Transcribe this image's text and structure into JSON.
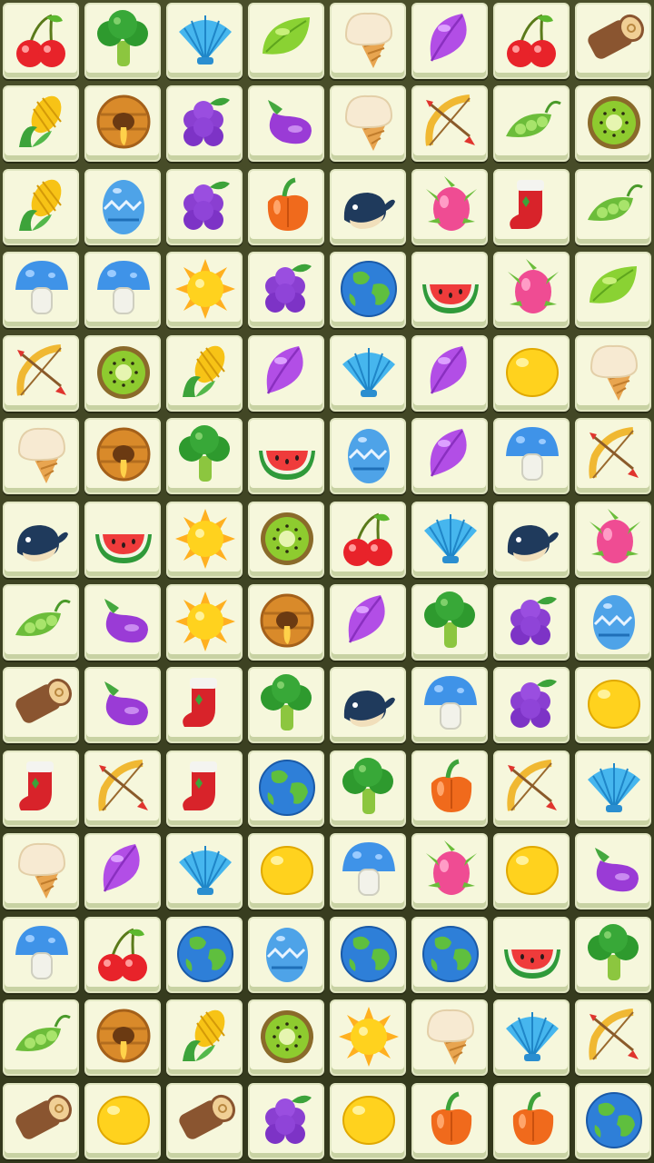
{
  "board": {
    "columns": 8,
    "rows": 14,
    "tiles": [
      [
        "cherry",
        "broccoli",
        "shell",
        "lime",
        "ice-cream",
        "leaf",
        "cherry",
        "log"
      ],
      [
        "corn",
        "honeycomb",
        "grapes",
        "eggplant",
        "ice-cream",
        "bow-arrow",
        "pea-pod",
        "kiwi"
      ],
      [
        "corn",
        "easter-egg",
        "grapes",
        "bell-pepper",
        "whale",
        "dragon-fruit",
        "christmas-stocking",
        "pea-pod"
      ],
      [
        "mushroom",
        "mushroom",
        "sun",
        "grapes",
        "globe",
        "watermelon",
        "dragon-fruit",
        "lime"
      ],
      [
        "bow-arrow",
        "kiwi",
        "corn",
        "leaf",
        "shell",
        "leaf",
        "lemon",
        "ice-cream"
      ],
      [
        "ice-cream",
        "honeycomb",
        "broccoli",
        "watermelon",
        "easter-egg",
        "leaf",
        "mushroom",
        "bow-arrow"
      ],
      [
        "whale",
        "watermelon",
        "sun",
        "kiwi",
        "cherry",
        "shell",
        "whale",
        "dragon-fruit"
      ],
      [
        "pea-pod",
        "eggplant",
        "sun",
        "honeycomb",
        "leaf",
        "broccoli",
        "grapes",
        "easter-egg"
      ],
      [
        "log",
        "eggplant",
        "christmas-stocking",
        "broccoli",
        "whale",
        "mushroom",
        "grapes",
        "lemon"
      ],
      [
        "christmas-stocking",
        "bow-arrow",
        "christmas-stocking",
        "globe",
        "broccoli",
        "bell-pepper",
        "bow-arrow",
        "shell"
      ],
      [
        "ice-cream",
        "leaf",
        "shell",
        "lemon",
        "mushroom",
        "dragon-fruit",
        "lemon",
        "eggplant"
      ],
      [
        "mushroom",
        "cherry",
        "globe",
        "easter-egg",
        "globe",
        "globe",
        "watermelon",
        "broccoli"
      ],
      [
        "pea-pod",
        "honeycomb",
        "corn",
        "kiwi",
        "sun",
        "ice-cream",
        "shell",
        "bow-arrow"
      ],
      [
        "log",
        "lemon",
        "log",
        "grapes",
        "lemon",
        "bell-pepper",
        "bell-pepper",
        "globe"
      ]
    ]
  }
}
